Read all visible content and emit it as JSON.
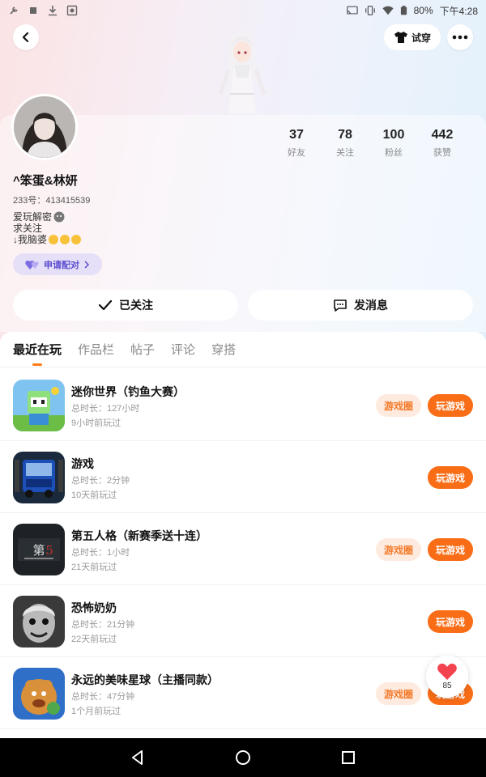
{
  "status_bar": {
    "battery": "80%",
    "time": "下午4:28"
  },
  "header": {
    "tryon_label": "试穿"
  },
  "profile": {
    "username": "^笨蛋&林妍",
    "id_line": "233号：413415539",
    "bio_line1": "爱玩解密",
    "bio_line2": "求关注",
    "bio_line3": "↓我脑婆",
    "pair_label": "申请配对",
    "stats": [
      {
        "num": "37",
        "label": "好友"
      },
      {
        "num": "78",
        "label": "关注"
      },
      {
        "num": "100",
        "label": "粉丝"
      },
      {
        "num": "442",
        "label": "获赞"
      }
    ],
    "follow_label": "已关注",
    "message_label": "发消息"
  },
  "tabs": [
    "最近在玩",
    "作品栏",
    "帖子",
    "评论",
    "穿搭"
  ],
  "games": [
    {
      "title": "迷你世界（钓鱼大赛）",
      "time": "总时长：127小时",
      "last": "9小时前玩过",
      "circle": "游戏圈",
      "play": "玩游戏"
    },
    {
      "title": "游戏",
      "time": "总时长：2分钟",
      "last": "10天前玩过",
      "circle": "",
      "play": "玩游戏"
    },
    {
      "title": "第五人格（新赛季送十连）",
      "time": "总时长：1小时",
      "last": "21天前玩过",
      "circle": "游戏圈",
      "play": "玩游戏"
    },
    {
      "title": "恐怖奶奶",
      "time": "总时长：21分钟",
      "last": "22天前玩过",
      "circle": "",
      "play": "玩游戏"
    },
    {
      "title": "永远的美味星球（主播同款）",
      "time": "总时长：47分钟",
      "last": "1个月前玩过",
      "circle": "游戏圈",
      "play": "玩游戏"
    }
  ],
  "like_float": {
    "count": "85"
  },
  "colors": {
    "accent": "#f96d16",
    "chip_bg": "#feeade",
    "pair_bg": "#e5e0f8",
    "pair_text": "#5d4fd0"
  }
}
